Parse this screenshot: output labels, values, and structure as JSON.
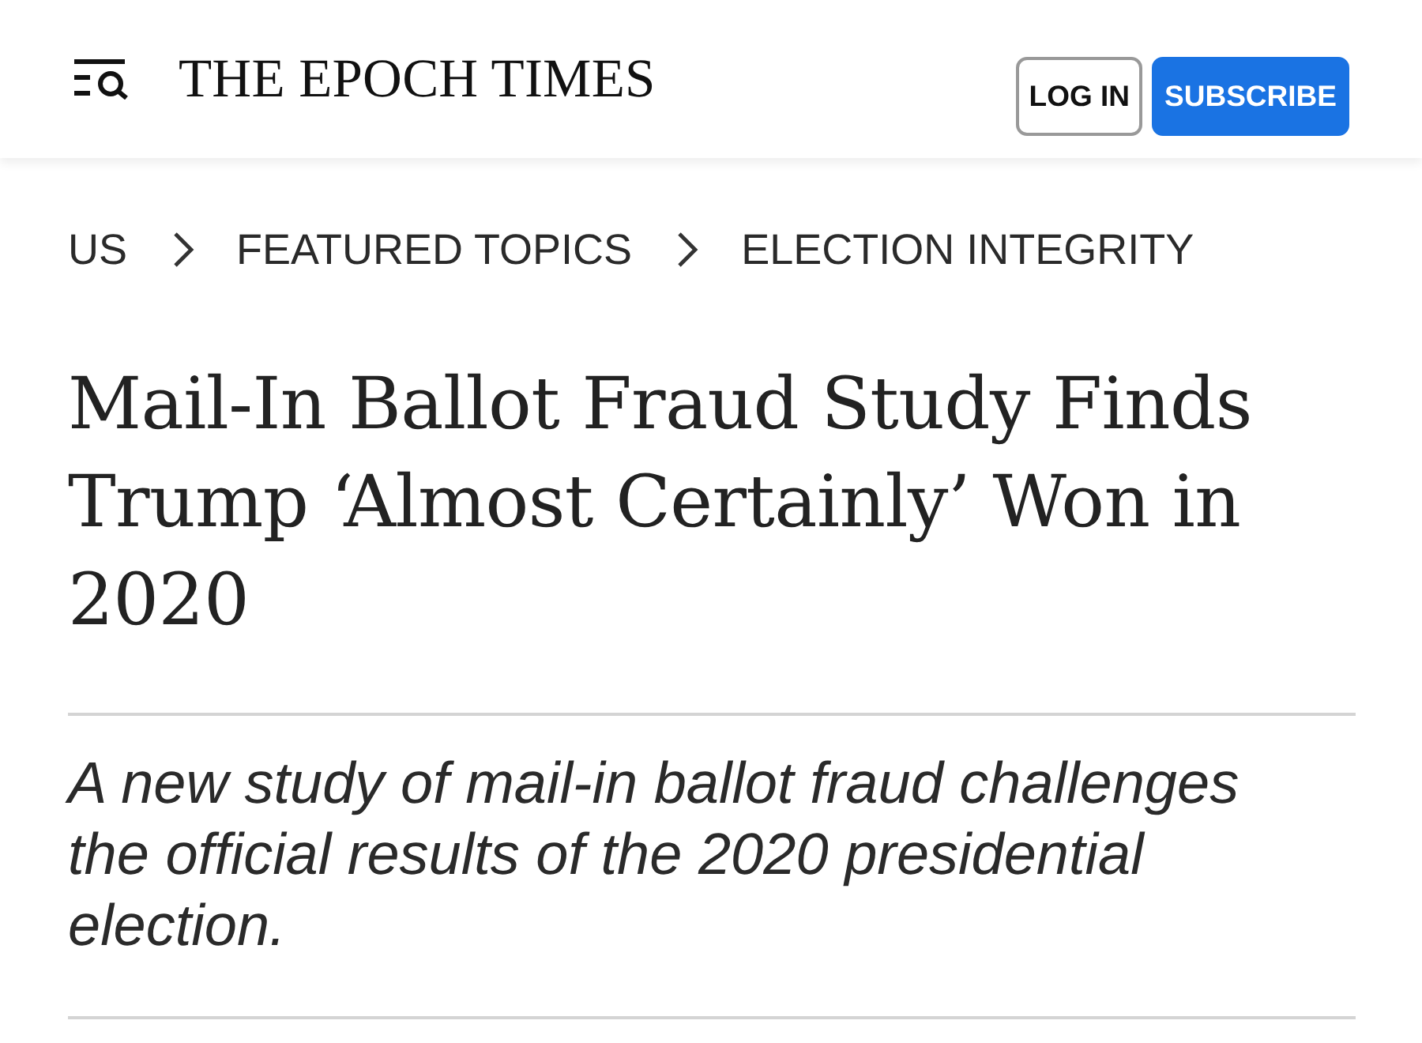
{
  "header": {
    "logo": "THE EPOCH TIMES",
    "buttons": [
      {
        "label": "LOG IN",
        "kind": "outline"
      },
      {
        "label": "SUBSCRIBE",
        "kind": "primary"
      }
    ]
  },
  "breadcrumb": [
    "US",
    "FEATURED TOPICS",
    "ELECTION INTEGRITY"
  ],
  "article": {
    "headline": "Mail-In Ballot Fraud Study Finds Trump ‘Almost Certainly’ Won in 2020",
    "summary": "A new study of mail-in ballot fraud challenges the official results of the 2020 presidential election."
  }
}
